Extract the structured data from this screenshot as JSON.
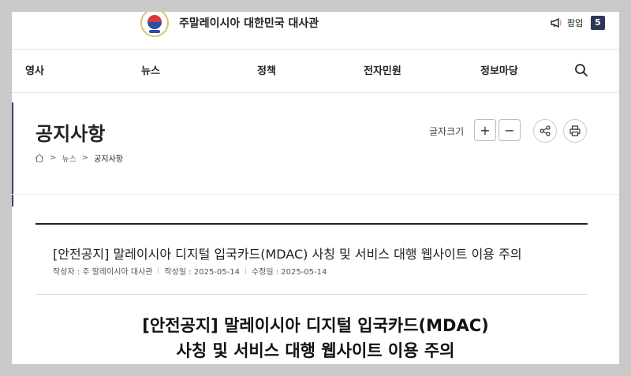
{
  "header": {
    "site_title": "주말레이시아 대한민국 대사관",
    "popup_label": "팝업",
    "popup_count": "5"
  },
  "nav": {
    "items": [
      "영사",
      "뉴스",
      "정책",
      "전자민원",
      "정보마당"
    ]
  },
  "page": {
    "title": "공지사항",
    "breadcrumb": [
      "뉴스",
      "공지사항"
    ],
    "font_size_label": "글자크기",
    "plus": "+",
    "minus": "−"
  },
  "article": {
    "title": "[안전공지] 말레이시아 디지털 입국카드(MDAC) 사칭 및 서비스 대행 웹사이트 이용 주의",
    "author": "작성자 : 주 말레이시아 대사관",
    "created": "작성일 : 2025-05-14",
    "modified": "수정일 : 2025-05-14",
    "heading_line1": "[안전공지] 말레이시아 디지털 입국카드(MDAC)",
    "heading_line2": "사칭 및 서비스 대행 웹사이트 이용 주의"
  },
  "icons": {
    "popup": "megaphone-icon",
    "search": "search-icon",
    "home": "home-icon",
    "share": "share-icon",
    "print": "print-icon"
  },
  "colors": {
    "badge": "#2c3656",
    "accent_bar": "#3a3f6e",
    "emblem_red": "#d43a3a",
    "emblem_blue": "#2a4fa6"
  }
}
